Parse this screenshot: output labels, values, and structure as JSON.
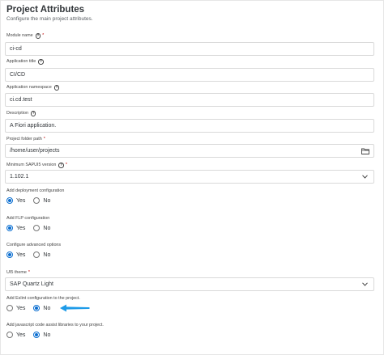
{
  "header": {
    "title": "Project Attributes",
    "subtitle": "Configure the main project attributes."
  },
  "fields": {
    "module_name": {
      "label": "Module name",
      "required": "*",
      "value": "ci-cd"
    },
    "application_title": {
      "label": "Application title",
      "value": "CI/CD"
    },
    "application_namespace": {
      "label": "Application namespace",
      "value": "ci.cd.test"
    },
    "description": {
      "label": "Description",
      "value": "A Fiori application."
    },
    "project_folder_path": {
      "label": "Project folder path",
      "required": "*",
      "value": "/home/user/projects"
    },
    "sapui5_version": {
      "label": "Minimum SAPUI5 version",
      "required": "*",
      "value": "1.102.1"
    },
    "ui5_theme": {
      "label": "UI5 theme",
      "required": "*",
      "value": "SAP Quartz Light"
    }
  },
  "options": {
    "deployment": {
      "label": "Add deployment configuration",
      "yes": "Yes",
      "no": "No",
      "selected": "Yes"
    },
    "flp": {
      "label": "Add FLP configuration",
      "yes": "Yes",
      "no": "No",
      "selected": "Yes"
    },
    "advanced": {
      "label": "Configure advanced options",
      "yes": "Yes",
      "no": "No",
      "selected": "Yes"
    },
    "eslint": {
      "label": "Add Eslint configuration to the project.",
      "yes": "Yes",
      "no": "No",
      "selected": "No"
    },
    "code_assist": {
      "label": "Add javascript code assist libraries to your project.",
      "yes": "Yes",
      "no": "No",
      "selected": "No"
    }
  },
  "icons": {
    "help": "question-circle-icon",
    "folder": "folder-icon",
    "dropdown": "chevron-down-icon",
    "annotation": "arrow-left-icon"
  },
  "colors": {
    "accent": "#0a6ed1",
    "required": "#bb0000",
    "annotation_arrow": "#1e9be8"
  }
}
